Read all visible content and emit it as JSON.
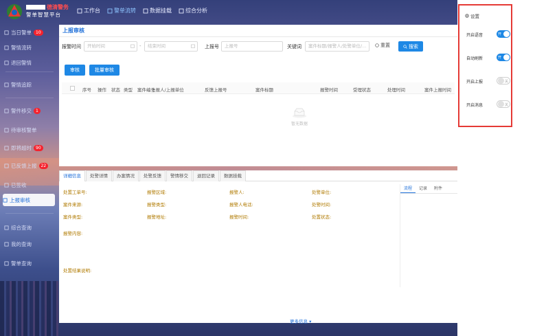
{
  "header": {
    "brand_line1": "",
    "brand_highlight": "德清警务",
    "brand_line2": "警单智慧平台",
    "nav": [
      {
        "label": "工作台",
        "icon": "monitor-icon",
        "active": false
      },
      {
        "label": "警单流转",
        "icon": "grid-icon",
        "active": true
      },
      {
        "label": "数据挂载",
        "icon": "tool-icon",
        "active": false
      },
      {
        "label": "综合分析",
        "icon": "chart-icon",
        "active": false
      }
    ]
  },
  "sidebar": {
    "items": [
      {
        "label": "当日警单",
        "badge": "10",
        "icon": "search-icon"
      },
      {
        "label": "警情流转",
        "badge": "",
        "icon": "list-icon"
      },
      {
        "label": "退回警情",
        "badge": "",
        "icon": "return-icon"
      },
      {
        "label": "警情追踪",
        "badge": "",
        "icon": "list-icon"
      },
      {
        "label": "警件移交",
        "badge": "1",
        "icon": "doc-icon"
      },
      {
        "label": "待审核警单",
        "badge": "",
        "icon": "doc-icon"
      },
      {
        "label": "即将超时",
        "badge": "90",
        "icon": "clock-icon"
      },
      {
        "label": "已反馈上报",
        "badge": "22",
        "icon": "check-icon"
      },
      {
        "label": "已签收",
        "badge": "",
        "icon": "check-icon"
      },
      {
        "label": "上报审核",
        "badge": "",
        "icon": "doc-icon",
        "active": true
      },
      {
        "label": "综合查询",
        "badge": "",
        "icon": "search-icon"
      },
      {
        "label": "我的查询",
        "badge": "",
        "icon": "user-icon"
      },
      {
        "label": "警单查询",
        "badge": "",
        "icon": "list-icon"
      }
    ]
  },
  "main": {
    "title": "上报审核",
    "filter": {
      "time_label": "报警时间",
      "start_placeholder": "开始时间",
      "end_placeholder": "结束时间",
      "report_label": "上报号",
      "report_placeholder": "上报号",
      "keyword_label": "关键词",
      "keyword_placeholder": "案件标题/报警人/处警单位/...",
      "reset_label": "重置",
      "search_label": "搜索"
    },
    "toolbar": {
      "approve_label": "审核",
      "batch_label": "批量审核"
    },
    "columns": [
      "序号",
      "操作",
      "状态",
      "类型",
      "案件编号",
      "上报人/上报单位",
      "反馈上报号",
      "案件标题",
      "报警时间",
      "受理状态",
      "处理时间",
      "案件上报时间"
    ],
    "empty_text": "暂无数据"
  },
  "detail": {
    "tabs": [
      "详细信息",
      "处警详情",
      "办案情况",
      "处警反馈",
      "警情移交",
      "退回记录",
      "数据挂载"
    ],
    "fields": [
      {
        "label": "处置工单号:"
      },
      {
        "label": "报警区域:"
      },
      {
        "label": "报警人:"
      },
      {
        "label": "处警单位:"
      },
      {
        "label": "案件来源:"
      },
      {
        "label": "报警类型:"
      },
      {
        "label": "报警人电话:"
      },
      {
        "label": "处警时间:"
      },
      {
        "label": "案件类型:"
      },
      {
        "label": "报警地址:"
      },
      {
        "label": "报警时间:"
      },
      {
        "label": "处置状态:"
      }
    ],
    "content_label": "报警内容:",
    "process_label": "处置结果说明:",
    "right_tabs": [
      "流程",
      "记录",
      "附件"
    ],
    "more_label": "更多信息"
  },
  "settings": {
    "title": "设置",
    "rows": [
      {
        "label": "开启语音",
        "on": true,
        "switch_text": "开"
      },
      {
        "label": "自动刷新",
        "on": true,
        "switch_text": "开"
      },
      {
        "label": "开启上报",
        "on": false,
        "switch_text": "关"
      },
      {
        "label": "开启消息",
        "on": false,
        "switch_text": "关"
      }
    ]
  },
  "colors": {
    "accent": "#1e88e5",
    "badge": "#f5222d",
    "frame": "#e53935"
  }
}
